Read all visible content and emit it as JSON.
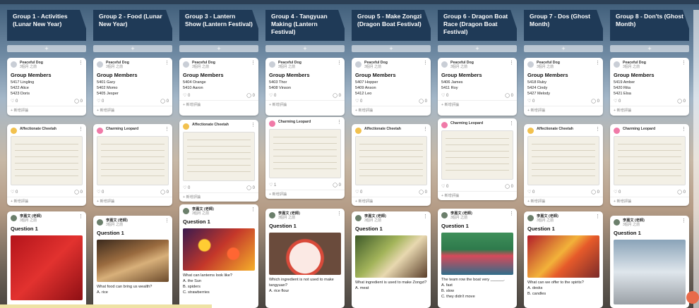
{
  "columns": [
    {
      "title": "Group 1 - Activities (Lunar New Year)",
      "add": "+",
      "members": {
        "author": "Peaceful Dog",
        "time": "3個月 之前",
        "title": "Group Members",
        "lines": [
          "5417 Lingling",
          "5422 Alice",
          "5423 Doris"
        ],
        "likes": "0",
        "comments": "0",
        "comment_prompt": "新增評論"
      },
      "work": {
        "author": "Affectionate Cheetah",
        "likes": "0",
        "comments": "0",
        "comment_prompt": "新增評論"
      },
      "question": {
        "author": "李嘉文 (老師)",
        "time": "3個月 之前",
        "title": "Question 1",
        "lines": []
      }
    },
    {
      "title": "Group 2 - Food (Lunar New Year)",
      "add": "+",
      "members": {
        "author": "Peaceful Dog",
        "time": "3個月 之前",
        "title": "Group Members",
        "lines": [
          "5401 Gary",
          "5402 Momo",
          "5405 Jesper"
        ],
        "likes": "0",
        "comments": "0",
        "comment_prompt": "新增評論"
      },
      "work": {
        "author": "Charming Leopard",
        "likes": "0",
        "comments": "0",
        "comment_prompt": "新增評論"
      },
      "question": {
        "author": "李嘉文 (老師)",
        "time": "3個月 之前",
        "title": "Question 1",
        "lines": [
          "What food can bring us wealth?",
          "A. rice"
        ]
      }
    },
    {
      "title": "Group 3 - Lantern Show (Lantern Festival)",
      "add": "+",
      "members": {
        "author": "Peaceful Dog",
        "time": "3個月 之前",
        "title": "Group Members",
        "lines": [
          "5404 Orange",
          "5410 Aaron"
        ],
        "likes": "0",
        "comments": "0",
        "comment_prompt": "新增評論"
      },
      "work": {
        "author": "Affectionate Cheetah",
        "likes": "0",
        "comments": "0",
        "comment_prompt": "新增評論"
      },
      "question": {
        "author": "李嘉文 (老師)",
        "time": "3個月 之前",
        "title": "Question 1",
        "lines": [
          "What can lanterns look like?",
          "A. the Sun",
          "B. spiders",
          "C. strawberries"
        ]
      }
    },
    {
      "title": "Group 4 - Tangyuan Making (Lantern Festival)",
      "add": "+",
      "members": {
        "author": "Peaceful Dog",
        "time": "3個月 之前",
        "title": "Group Members",
        "lines": [
          "5403 Thor",
          "5408 Vinson"
        ],
        "likes": "0",
        "comments": "0",
        "comment_prompt": "新增評論"
      },
      "work": {
        "author": "Charming Leopard",
        "likes": "1",
        "comments": "0",
        "comment_prompt": "新增評論"
      },
      "question": {
        "author": "李嘉文 (老師)",
        "time": "3個月 之前",
        "title": "Question 1",
        "lines": [
          "Which ingredient is not used to make tangyuan?",
          "A. rice flour"
        ]
      }
    },
    {
      "title": "Group 5 - Make Zongzi (Dragon Boat Festival)",
      "add": "+",
      "members": {
        "author": "Peaceful Dog",
        "time": "3個月 之前",
        "title": "Group Members",
        "lines": [
          "5407 Hopper",
          "5409 Anson",
          "5412 Leo"
        ],
        "likes": "0",
        "comments": "0",
        "comment_prompt": "新增評論"
      },
      "work": {
        "author": "Affectionate Cheetah",
        "likes": "0",
        "comments": "0",
        "comment_prompt": "新增評論"
      },
      "question": {
        "author": "李嘉文 (老師)",
        "time": "3個月 之前",
        "title": "Question 1",
        "lines": [
          "What ingredient is used to make Zongzi?",
          "A. meat"
        ]
      }
    },
    {
      "title": "Group 6 - Dragon Boat Race (Dragon Boat Festival)",
      "add": "+",
      "members": {
        "author": "Peaceful Dog",
        "time": "3個月 之前",
        "title": "Group Members",
        "lines": [
          "5406 James",
          "5411 Roy"
        ],
        "likes": "0",
        "comments": "0",
        "comment_prompt": "新增評論"
      },
      "work": {
        "author": "Charming Leopard",
        "likes": "0",
        "comments": "0",
        "comment_prompt": "新增評論"
      },
      "question": {
        "author": "李嘉文 (老師)",
        "time": "3個月 之前",
        "title": "Question 1",
        "lines": [
          "The team row the boat very ______.",
          "A. fast",
          "B. slow",
          "C. they didn't move"
        ]
      }
    },
    {
      "title": "Group 7 - Dos (Ghost Month)",
      "add": "+",
      "members": {
        "author": "Peaceful Dog",
        "time": "3個月 之前",
        "title": "Group Members",
        "lines": [
          "5418 Ruby",
          "5424 Cindy",
          "5427 Melody"
        ],
        "likes": "0",
        "comments": "0",
        "comment_prompt": "新增評論"
      },
      "work": {
        "author": "Affectionate Cheetah",
        "likes": "0",
        "comments": "0",
        "comment_prompt": "新增評論"
      },
      "question": {
        "author": "李嘉文 (老師)",
        "time": "3個月 之前",
        "title": "Question 1",
        "lines": [
          "What can we offer to the spirits?",
          "A. desks",
          "B. candles"
        ]
      }
    },
    {
      "title": "Group 8 - Don'ts (Ghost Month)",
      "add": "+",
      "members": {
        "author": "Peaceful Dog",
        "time": "3個月 之前",
        "title": "Group Members",
        "lines": [
          "5419 Amber",
          "5420 Rita",
          "5421 Elsa"
        ],
        "likes": "0",
        "comments": "0",
        "comment_prompt": "新增評論"
      },
      "work": {
        "author": "Charming Leopard",
        "likes": "0",
        "comments": "0",
        "comment_prompt": "新增評論"
      },
      "question": {
        "author": "李嘉文 (老師)",
        "time": "3個月 之前",
        "title": "Question 1",
        "lines": []
      }
    }
  ],
  "colors": {
    "header": "#1f3a57",
    "accent_fab": "#e86a4a"
  }
}
